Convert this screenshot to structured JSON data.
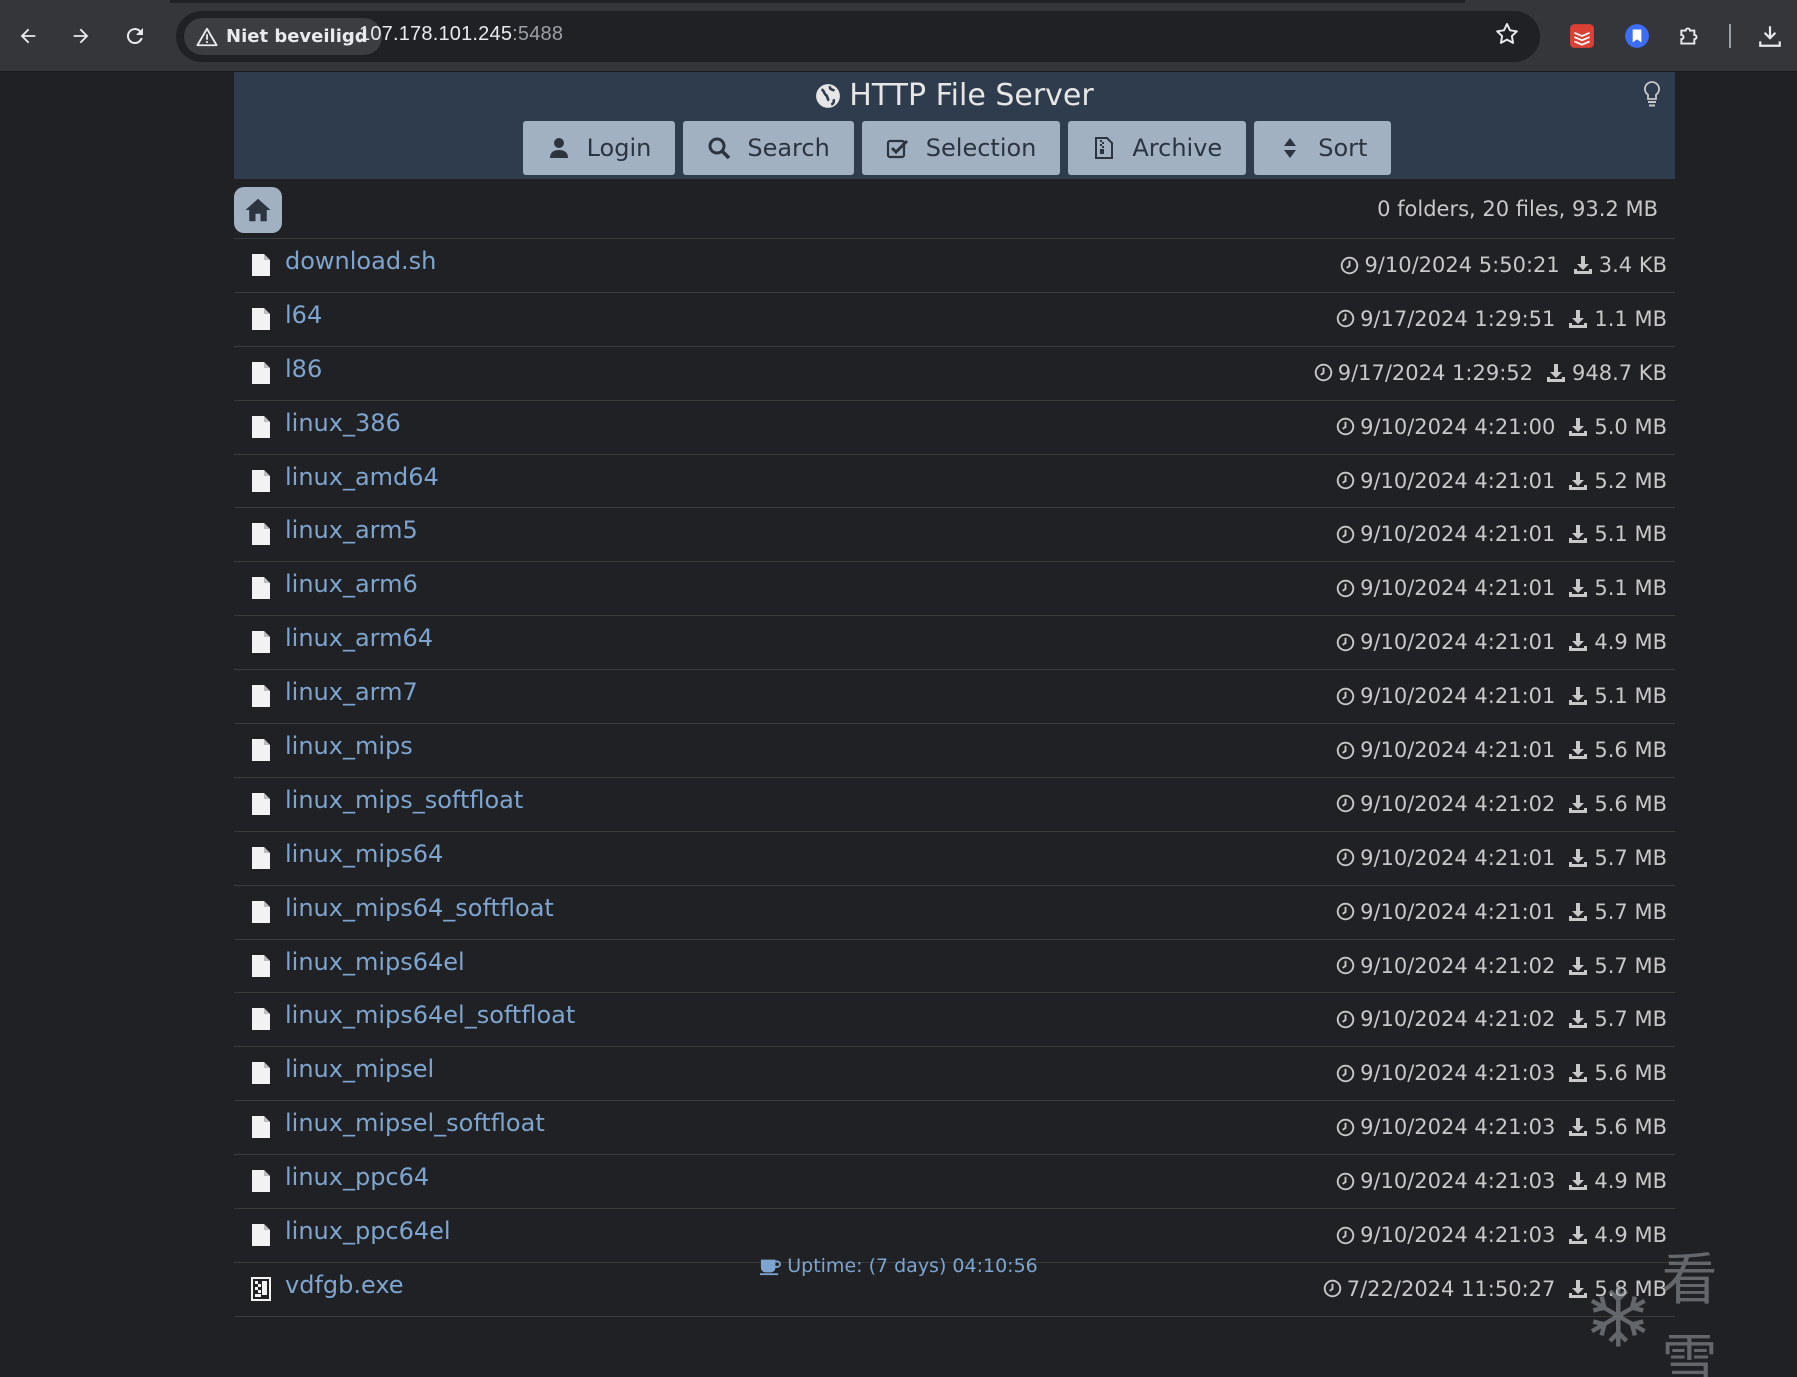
{
  "browser": {
    "security_label": "Niet beveiligd",
    "url_host": "107.178.101.245",
    "url_port": ":5488"
  },
  "page": {
    "title": "HTTP File Server",
    "toolbar": {
      "login": "Login",
      "search": "Search",
      "selection": "Selection",
      "archive": "Archive",
      "sort": "Sort"
    },
    "summary": "0 folders, 20 files, 93.2 MB",
    "files": [
      {
        "name": "download.sh",
        "date": "9/10/2024 5:50:21",
        "size": "3.4 KB",
        "type": "file"
      },
      {
        "name": "l64",
        "date": "9/17/2024 1:29:51",
        "size": "1.1 MB",
        "type": "file"
      },
      {
        "name": "l86",
        "date": "9/17/2024 1:29:52",
        "size": "948.7 KB",
        "type": "file"
      },
      {
        "name": "linux_386",
        "date": "9/10/2024 4:21:00",
        "size": "5.0 MB",
        "type": "file"
      },
      {
        "name": "linux_amd64",
        "date": "9/10/2024 4:21:01",
        "size": "5.2 MB",
        "type": "file"
      },
      {
        "name": "linux_arm5",
        "date": "9/10/2024 4:21:01",
        "size": "5.1 MB",
        "type": "file"
      },
      {
        "name": "linux_arm6",
        "date": "9/10/2024 4:21:01",
        "size": "5.1 MB",
        "type": "file"
      },
      {
        "name": "linux_arm64",
        "date": "9/10/2024 4:21:01",
        "size": "4.9 MB",
        "type": "file"
      },
      {
        "name": "linux_arm7",
        "date": "9/10/2024 4:21:01",
        "size": "5.1 MB",
        "type": "file"
      },
      {
        "name": "linux_mips",
        "date": "9/10/2024 4:21:01",
        "size": "5.6 MB",
        "type": "file"
      },
      {
        "name": "linux_mips_softfloat",
        "date": "9/10/2024 4:21:02",
        "size": "5.6 MB",
        "type": "file"
      },
      {
        "name": "linux_mips64",
        "date": "9/10/2024 4:21:01",
        "size": "5.7 MB",
        "type": "file"
      },
      {
        "name": "linux_mips64_softfloat",
        "date": "9/10/2024 4:21:01",
        "size": "5.7 MB",
        "type": "file"
      },
      {
        "name": "linux_mips64el",
        "date": "9/10/2024 4:21:02",
        "size": "5.7 MB",
        "type": "file"
      },
      {
        "name": "linux_mips64el_softfloat",
        "date": "9/10/2024 4:21:02",
        "size": "5.7 MB",
        "type": "file"
      },
      {
        "name": "linux_mipsel",
        "date": "9/10/2024 4:21:03",
        "size": "5.6 MB",
        "type": "file"
      },
      {
        "name": "linux_mipsel_softfloat",
        "date": "9/10/2024 4:21:03",
        "size": "5.6 MB",
        "type": "file"
      },
      {
        "name": "linux_ppc64",
        "date": "9/10/2024 4:21:03",
        "size": "4.9 MB",
        "type": "file"
      },
      {
        "name": "linux_ppc64el",
        "date": "9/10/2024 4:21:03",
        "size": "4.9 MB",
        "type": "file"
      },
      {
        "name": "vdfgb.exe",
        "date": "7/22/2024 11:50:27",
        "size": "5.8 MB",
        "type": "exe"
      }
    ],
    "uptime": "Uptime: (7 days) 04:10:56",
    "watermark": "看雪"
  },
  "colors": {
    "header_bg": "#2e3c4d",
    "button_bg": "#a1b1c2",
    "link": "#7ea5cf",
    "page_bg": "#202124"
  }
}
